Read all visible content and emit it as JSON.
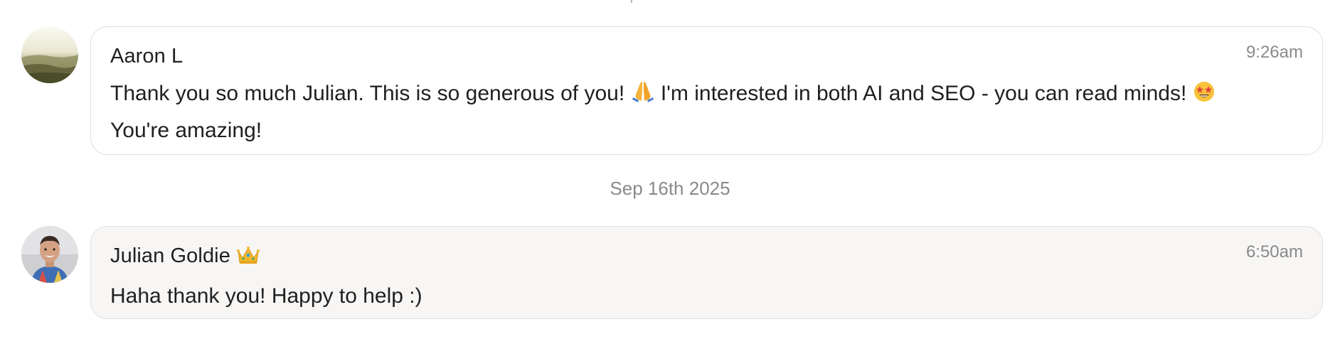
{
  "messages": [
    {
      "author": "Aaron L",
      "time": "9:26am",
      "text_line1": "Thank you so much Julian. This is so generous of you! ",
      "text_line1b": " I'm interested in both AI and SEO - you can read minds! ",
      "text_line2": "You're amazing!",
      "emoji1": "folded-hands",
      "emoji2": "star-struck",
      "bubble_color": "#ffffff"
    },
    {
      "author": "Julian Goldie",
      "author_badge": "crown",
      "time": "6:50am",
      "text": "Haha thank you! Happy to help :)",
      "bubble_color": "#f7f6f5"
    }
  ],
  "date_separator": "Sep 16th 2025",
  "colors": {
    "border": "#e0e0e0",
    "muted_text": "#8a8a8a",
    "body_text": "#202020"
  }
}
